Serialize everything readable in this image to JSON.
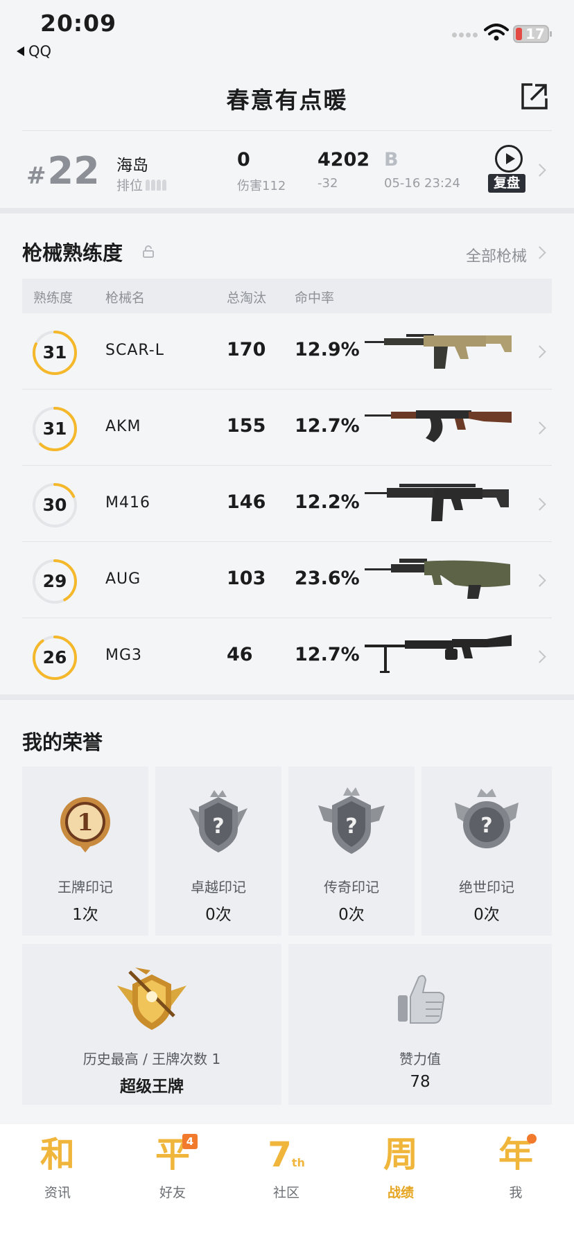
{
  "status_bar": {
    "time": "20:09",
    "back_label": "QQ",
    "battery": "17"
  },
  "header": {
    "title": "春意有点暖"
  },
  "match": {
    "rank_hash": "#",
    "rank": "22",
    "map": "海岛",
    "mode_label": "排位",
    "kills": "0",
    "damage": "伤害112",
    "rating": "4202",
    "rating_change": "-32",
    "grade": "B",
    "datetime": "05-16 23:24",
    "replay_label": "复盘"
  },
  "weapons": {
    "title": "枪械熟练度",
    "all_label": "全部枪械",
    "columns": [
      "熟练度",
      "枪械名",
      "总淘汰",
      "命中率"
    ],
    "rows": [
      {
        "level": "31",
        "progress": 0.82,
        "name": "SCAR-L",
        "kills": "170",
        "accuracy": "12.9%"
      },
      {
        "level": "31",
        "progress": 0.62,
        "name": "AKM",
        "kills": "155",
        "accuracy": "12.7%"
      },
      {
        "level": "30",
        "progress": 0.18,
        "name": "M416",
        "kills": "146",
        "accuracy": "12.2%"
      },
      {
        "level": "29",
        "progress": 0.42,
        "name": "AUG",
        "kills": "103",
        "accuracy": "23.6%"
      },
      {
        "level": "26",
        "progress": 0.9,
        "name": "MG3",
        "kills": "46",
        "accuracy": "12.7%"
      }
    ]
  },
  "honor": {
    "title": "我的荣誉",
    "marks": [
      {
        "label": "王牌印记",
        "value": "1次",
        "icon": "ace-medal-icon",
        "badge_text": "1"
      },
      {
        "label": "卓越印记",
        "value": "0次",
        "icon": "locked-crown-badge-icon",
        "badge_text": "?"
      },
      {
        "label": "传奇印记",
        "value": "0次",
        "icon": "locked-wing-badge-icon",
        "badge_text": "?"
      },
      {
        "label": "绝世印记",
        "value": "0次",
        "icon": "locked-shield-badge-icon",
        "badge_text": "?"
      }
    ],
    "best": {
      "label": "历史最高 / 王牌次数 1",
      "value": "超级王牌",
      "icon": "super-ace-tier-icon"
    },
    "likes": {
      "label": "赞力值",
      "value": "78",
      "icon": "thumbs-up-icon"
    }
  },
  "tabs": [
    {
      "glyph": "和",
      "label": "资讯"
    },
    {
      "glyph": "平",
      "label": "好友",
      "badge": "4"
    },
    {
      "glyph": "7",
      "glyph_sub": "th",
      "label": "社区"
    },
    {
      "glyph": "周",
      "label": "战绩",
      "active": true
    },
    {
      "glyph": "年",
      "label": "我",
      "dot": true
    }
  ],
  "colors": {
    "accent": "#f5b82b",
    "active_tab": "#e6a520",
    "badge": "#f27a2c",
    "battery_low": "#e24a43"
  }
}
